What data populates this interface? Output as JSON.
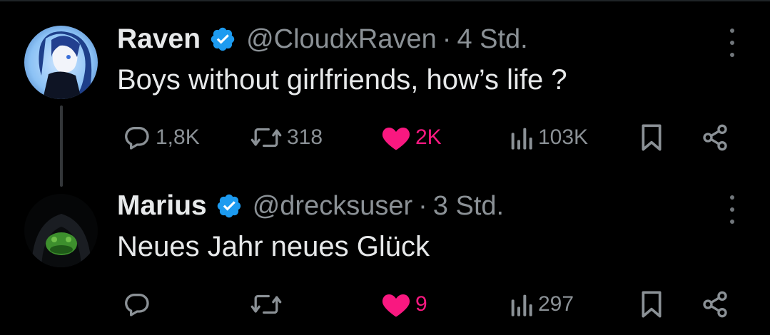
{
  "tweets": [
    {
      "name": "Raven",
      "handle": "@CloudxRaven",
      "separator": "·",
      "time": "4 Std.",
      "text": "Boys without girlfriends, how’s life ?",
      "replies": "1,8K",
      "reposts": "318",
      "likes": "2K",
      "views": "103K",
      "liked": true,
      "has_thread_line": true
    },
    {
      "name": "Marius",
      "handle": "@drecksuser",
      "separator": "·",
      "time": "3 Std.",
      "text": "Neues Jahr neues Glück",
      "replies": "",
      "reposts": "",
      "likes": "9",
      "views": "297",
      "liked": true,
      "has_thread_line": false
    }
  ],
  "colors": {
    "background": "#000000",
    "text": "#e7e9ea",
    "secondary": "#8b9196",
    "like": "#f91880",
    "verified": "#1d9bf0"
  },
  "icons": [
    "verified-badge-icon",
    "more-options-icon",
    "reply-icon",
    "repost-icon",
    "like-icon",
    "views-icon",
    "bookmark-icon",
    "share-icon"
  ]
}
